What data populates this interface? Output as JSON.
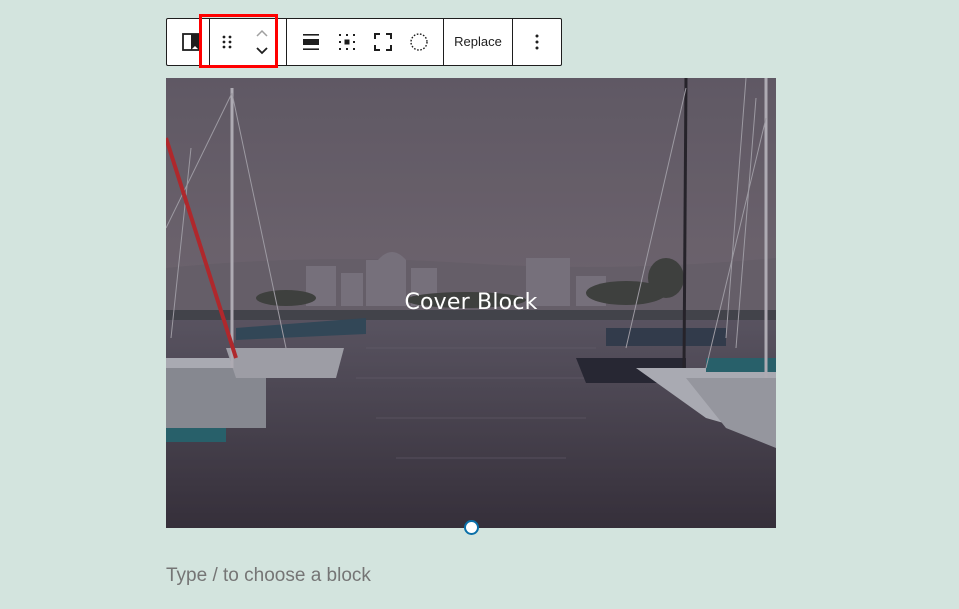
{
  "toolbar": {
    "block_type_icon": "cover-block-icon",
    "drag_icon": "drag-handle-icon",
    "move_up_icon": "chevron-up-icon",
    "move_down_icon": "chevron-down-icon",
    "align_icon": "align-full-icon",
    "content_position_icon": "content-position-icon",
    "full_height_icon": "full-height-icon",
    "duotone_icon": "duotone-circle-icon",
    "replace_label": "Replace",
    "more_icon": "more-vertical-icon"
  },
  "highlight_color": "#ff0000",
  "cover": {
    "title": "Cover Block",
    "overlay_color": "#4a3f4e"
  },
  "appender": {
    "placeholder": "Type / to choose a block"
  },
  "colors": {
    "background": "#d3e4de",
    "accent": "#0a6fa8"
  }
}
